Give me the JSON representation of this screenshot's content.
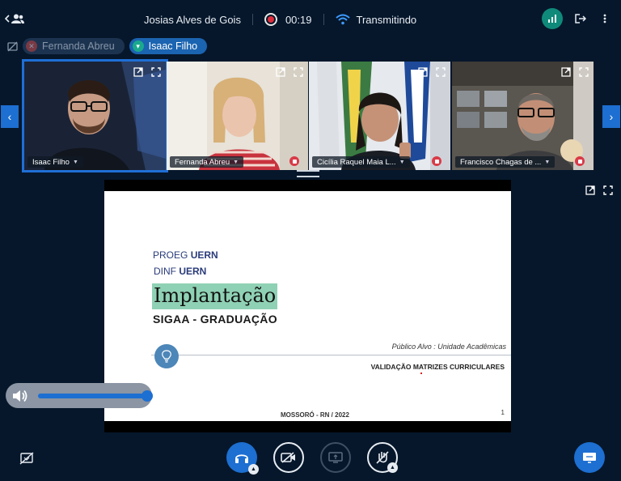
{
  "header": {
    "host_name": "Josias Alves de Gois",
    "timer": "00:19",
    "stream_status": "Transmitindo"
  },
  "talking": {
    "speakers": [
      {
        "name": "Fernanda Abreu",
        "state": "muted"
      },
      {
        "name": "Isaac Filho",
        "state": "talking"
      }
    ]
  },
  "videos": [
    {
      "name": "Isaac Filho",
      "muted": false,
      "selected": true
    },
    {
      "name": "Fernanda Abreu",
      "muted": true,
      "selected": false
    },
    {
      "name": "Cicília Raquel Maia L...",
      "muted": true,
      "selected": false
    },
    {
      "name": "Francisco Chagas de ...",
      "muted": true,
      "selected": false
    }
  ],
  "slide": {
    "line1_prefix": "PROEG ",
    "line1_bold": "UERN",
    "line2_prefix": "DINF ",
    "line2_bold": "UERN",
    "title": "Implantação",
    "subtitle": "SIGAA - GRADUAÇÃO",
    "audience": "Público Alvo : Unidade Acadêmicas",
    "validation": "VALIDAÇÃO MATRIZES CURRICULARES",
    "place": "MOSSORÓ - RN / 2022",
    "page": "1"
  },
  "volume": {
    "level": 1.0
  },
  "colors": {
    "background": "#06172b",
    "accent": "#1d6fd1",
    "stats": "#0f8a7a",
    "record": "#e02d3c",
    "title_highlight": "#8fd1b4"
  }
}
